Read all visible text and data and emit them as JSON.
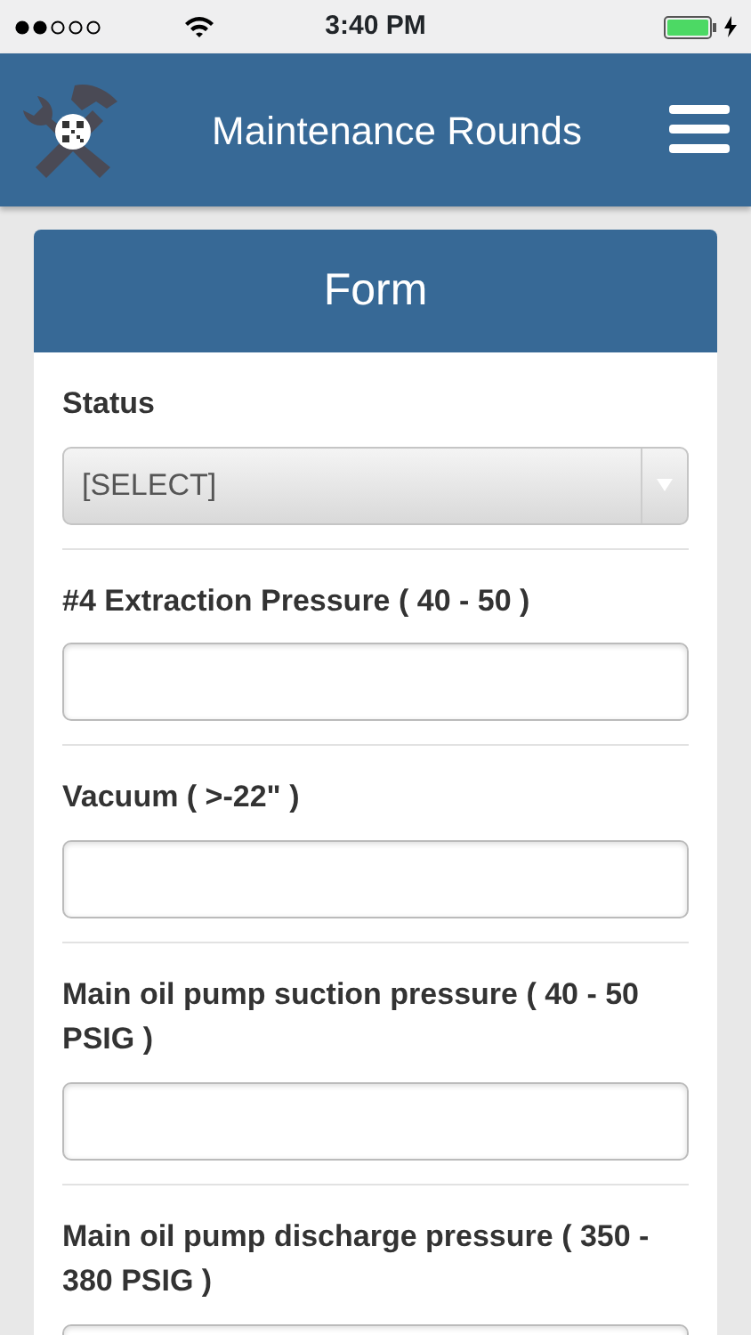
{
  "status_bar": {
    "time": "3:40 PM"
  },
  "header": {
    "title": "Maintenance Rounds"
  },
  "form": {
    "title": "Form",
    "fields": [
      {
        "kind": "select",
        "label": "Status",
        "value": "[SELECT]"
      },
      {
        "kind": "text",
        "label": "#4 Extraction Pressure ( 40 - 50 )"
      },
      {
        "kind": "text",
        "label": "Vacuum ( >-22\" )"
      },
      {
        "kind": "text",
        "label": "Main oil pump suction pressure ( 40 - 50 PSIG )"
      },
      {
        "kind": "text",
        "label": "Main oil pump discharge pressure ( 350 - 380 PSIG )"
      }
    ]
  }
}
